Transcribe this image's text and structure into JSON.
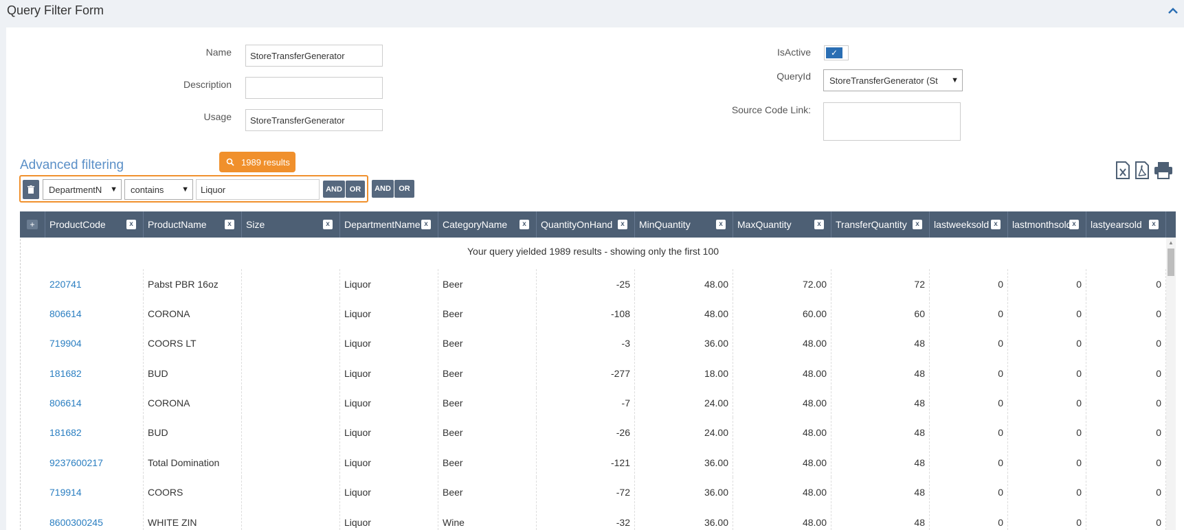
{
  "form": {
    "title": "Query Filter Form",
    "name_label": "Name",
    "name_value": "StoreTransferGenerator",
    "description_label": "Description",
    "description_value": "",
    "usage_label": "Usage",
    "usage_value": "StoreTransferGenerator",
    "isactive_label": "IsActive",
    "isactive_checked": true,
    "queryid_label": "QueryId",
    "queryid_value": "StoreTransferGenerator (St",
    "source_label": "Source Code Link:",
    "source_value": ""
  },
  "advanced": {
    "title": "Advanced filtering",
    "results_badge": "1989 results",
    "field": "DepartmentN",
    "operator": "contains",
    "value": "Liquor",
    "and_label": "AND",
    "or_label": "OR"
  },
  "toolbar": {
    "excel_icon": "excel-export-icon",
    "pdf_icon": "pdf-export-icon",
    "print_icon": "print-icon"
  },
  "grid": {
    "columns": [
      "ProductCode",
      "ProductName",
      "Size",
      "DepartmentName",
      "CategoryName",
      "QuantityOnHand",
      "MinQuantity",
      "MaxQuantity",
      "TransferQuantity",
      "lastweeksold",
      "lastmonthsold",
      "lastyearsold"
    ],
    "notice": "Your query yielded 1989 results - showing only the first 100",
    "rows": [
      [
        "220741",
        "Pabst PBR 16oz",
        "",
        "Liquor",
        "Beer",
        "-25",
        "48.00",
        "72.00",
        "72",
        "0",
        "0",
        "0"
      ],
      [
        "806614",
        "CORONA",
        "",
        "Liquor",
        "Beer",
        "-108",
        "48.00",
        "60.00",
        "60",
        "0",
        "0",
        "0"
      ],
      [
        "719904",
        "COORS LT",
        "",
        "Liquor",
        "Beer",
        "-3",
        "36.00",
        "48.00",
        "48",
        "0",
        "0",
        "0"
      ],
      [
        "181682",
        "BUD",
        "",
        "Liquor",
        "Beer",
        "-277",
        "18.00",
        "48.00",
        "48",
        "0",
        "0",
        "0"
      ],
      [
        "806614",
        "CORONA",
        "",
        "Liquor",
        "Beer",
        "-7",
        "24.00",
        "48.00",
        "48",
        "0",
        "0",
        "0"
      ],
      [
        "181682",
        "BUD",
        "",
        "Liquor",
        "Beer",
        "-26",
        "24.00",
        "48.00",
        "48",
        "0",
        "0",
        "0"
      ],
      [
        "9237600217",
        "Total Domination",
        "",
        "Liquor",
        "Beer",
        "-121",
        "36.00",
        "48.00",
        "48",
        "0",
        "0",
        "0"
      ],
      [
        "719914",
        "COORS",
        "",
        "Liquor",
        "Beer",
        "-72",
        "36.00",
        "48.00",
        "48",
        "0",
        "0",
        "0"
      ],
      [
        "8600300245",
        "WHITE ZIN",
        "",
        "Liquor",
        "Wine",
        "-32",
        "36.00",
        "48.00",
        "48",
        "0",
        "0",
        "0"
      ]
    ]
  }
}
